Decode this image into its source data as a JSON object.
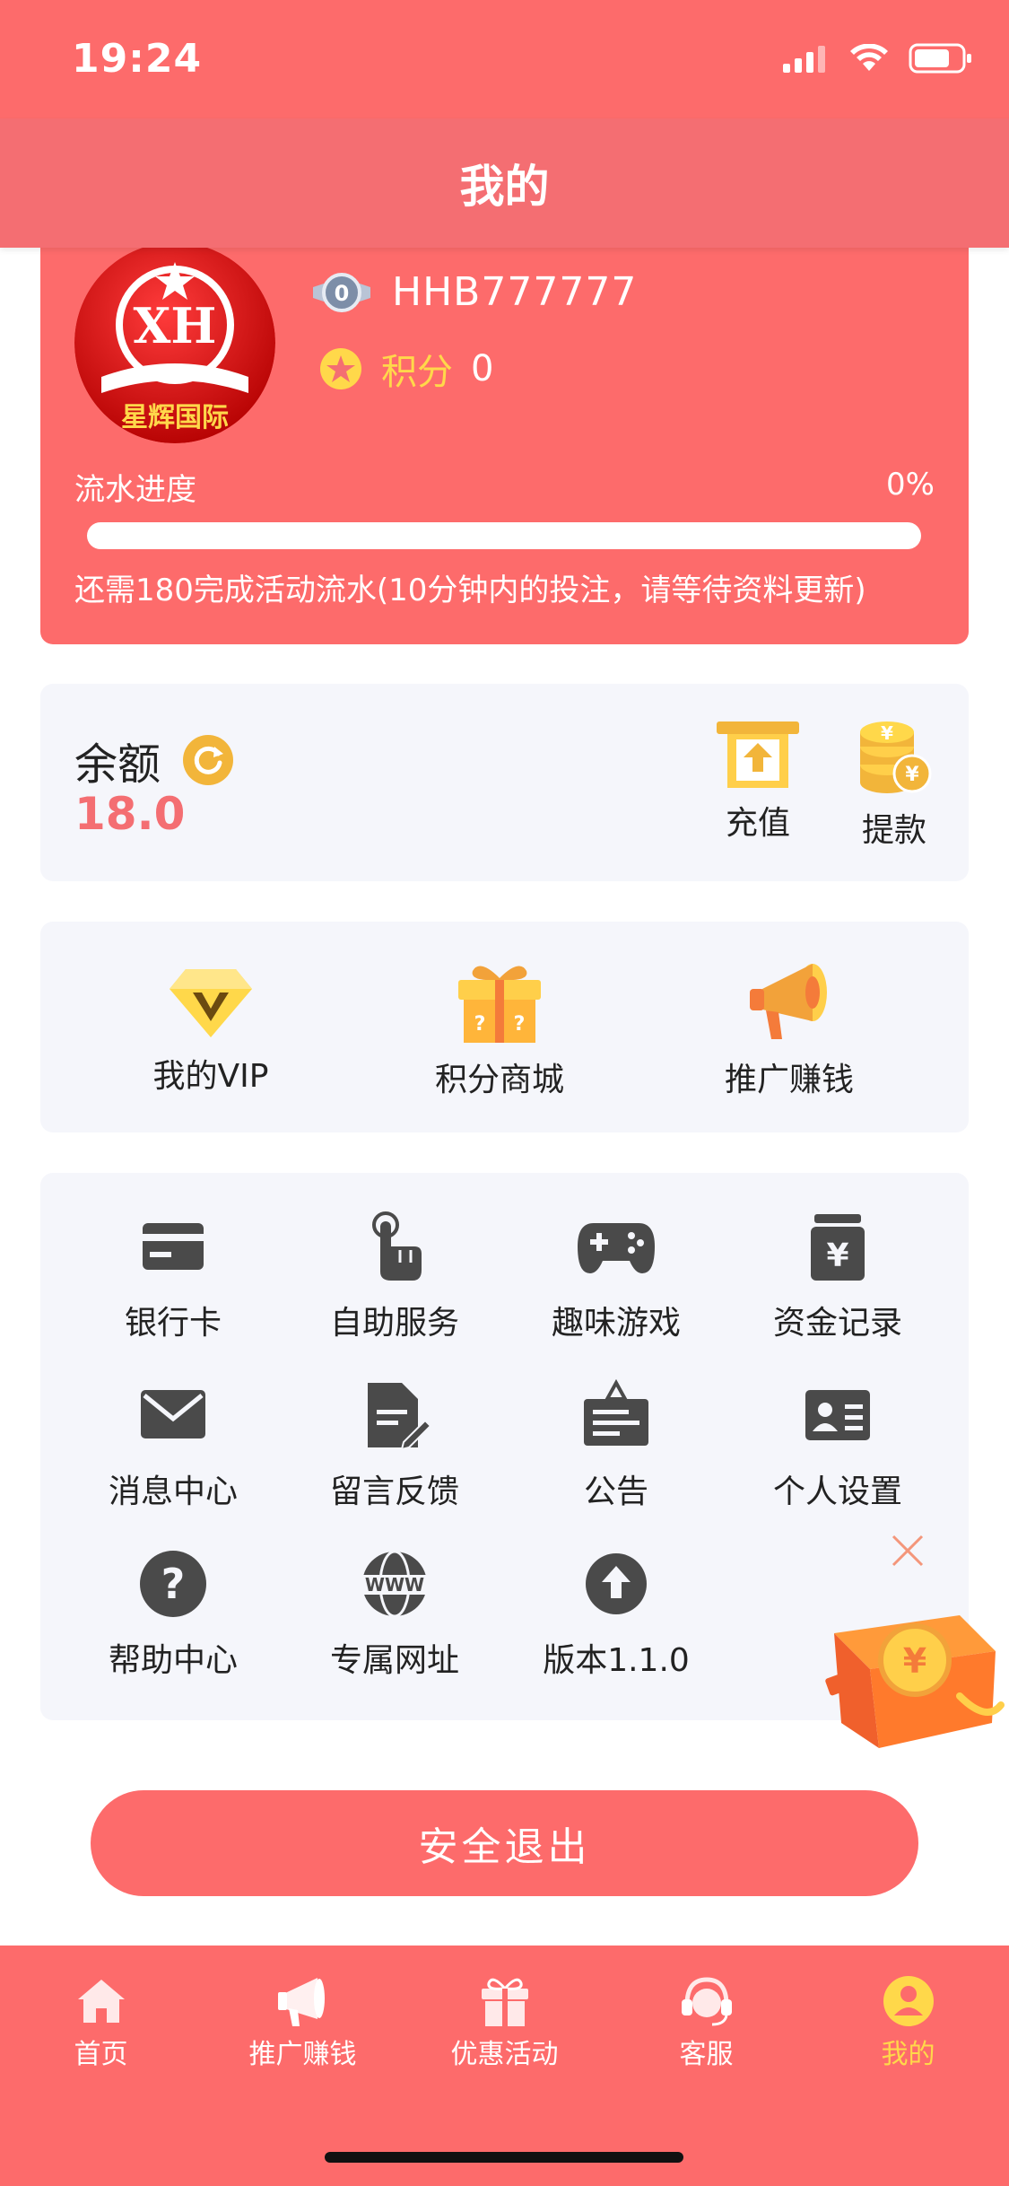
{
  "status_bar": {
    "time": "19:24"
  },
  "header": {
    "title": "我的"
  },
  "profile": {
    "avatar_text": "星辉国际",
    "level_badge": "0",
    "username": "HHB777777",
    "points_label": "积分",
    "points_value": "0",
    "progress_label": "流水进度",
    "progress_percent": "0%",
    "progress_fraction": 0,
    "progress_note": "还需180完成活动流水(10分钟内的投注，请等待资料更新)"
  },
  "balance": {
    "label": "余额",
    "value": "18.0",
    "recharge_label": "充值",
    "withdraw_label": "提款"
  },
  "quick_links": [
    {
      "label": "我的VIP",
      "icon": "vip-diamond-icon"
    },
    {
      "label": "积分商城",
      "icon": "gift-box-icon"
    },
    {
      "label": "推广赚钱",
      "icon": "megaphone-icon"
    }
  ],
  "menu": [
    {
      "label": "银行卡",
      "icon": "bank-card-icon"
    },
    {
      "label": "自助服务",
      "icon": "tap-hand-icon"
    },
    {
      "label": "趣味游戏",
      "icon": "gamepad-icon"
    },
    {
      "label": "资金记录",
      "icon": "fund-record-icon"
    },
    {
      "label": "消息中心",
      "icon": "envelope-icon"
    },
    {
      "label": "留言反馈",
      "icon": "feedback-icon"
    },
    {
      "label": "公告",
      "icon": "notice-board-icon"
    },
    {
      "label": "个人设置",
      "icon": "id-card-icon"
    },
    {
      "label": "帮助中心",
      "icon": "help-icon"
    },
    {
      "label": "专属网址",
      "icon": "globe-www-icon"
    },
    {
      "label": "版本1.1.0",
      "icon": "upload-icon"
    }
  ],
  "logout": {
    "label": "安全退出"
  },
  "tabs": [
    {
      "label": "首页",
      "icon": "home-icon"
    },
    {
      "label": "推广赚钱",
      "icon": "megaphone-icon"
    },
    {
      "label": "优惠活动",
      "icon": "gift-icon"
    },
    {
      "label": "客服",
      "icon": "headset-icon"
    },
    {
      "label": "我的",
      "icon": "user-icon",
      "active": true
    }
  ],
  "colors": {
    "brand": "#fd6b6b",
    "accent_yellow": "#ffd84a",
    "panel_bg": "#f5f6fb",
    "icon_dark": "#4a4a4a"
  }
}
